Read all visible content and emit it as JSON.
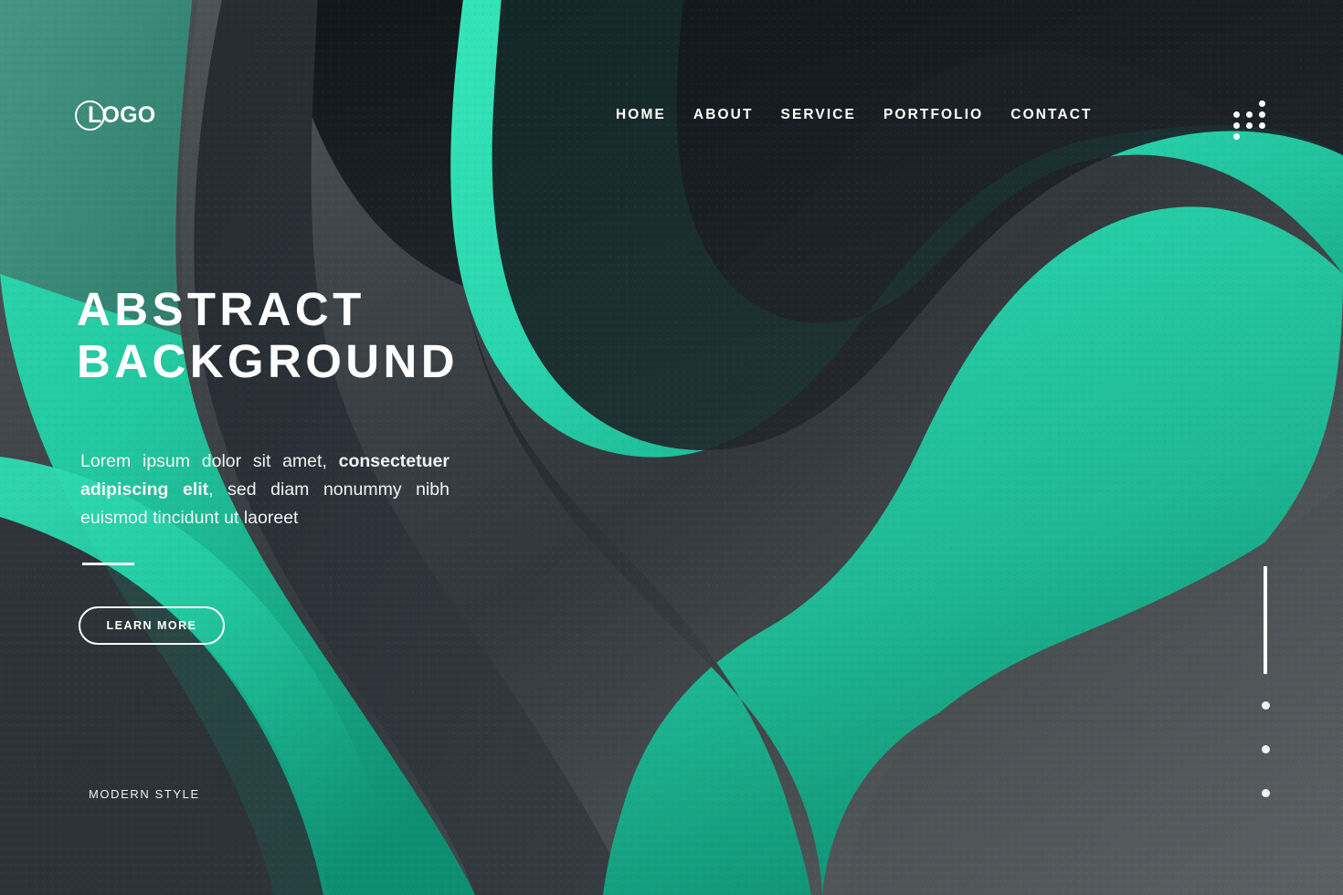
{
  "theme": {
    "accent_teal": "#2ad6ae",
    "accent_teal_deep": "#10937a",
    "dark_navy": "#151a1e",
    "panel_dark": "#2a3036",
    "grey_light": "#5d6265",
    "text_white": "#ffffff"
  },
  "header": {
    "logo": {
      "text": "LOGO",
      "ring_icon": "circle-outline-icon"
    },
    "nav": [
      {
        "label": "HOME"
      },
      {
        "label": "ABOUT"
      },
      {
        "label": "SERVICE"
      },
      {
        "label": "PORTFOLIO"
      },
      {
        "label": "CONTACT"
      }
    ],
    "menu_icon": "dot-grid-icon"
  },
  "hero": {
    "heading_line1": "ABSTRACT",
    "heading_line2": "BACKGROUND",
    "paragraph": {
      "part1": "Lorem ipsum dolor sit amet, ",
      "bold": "consectetuer adipiscing elit",
      "part2": ", sed diam nonummy nibh euismod tincidunt ut laoreet"
    },
    "cta_label": "LEARN MORE",
    "tagline": "MODERN STYLE"
  },
  "slide_indicator": {
    "active_bar": true,
    "dots": 3
  }
}
